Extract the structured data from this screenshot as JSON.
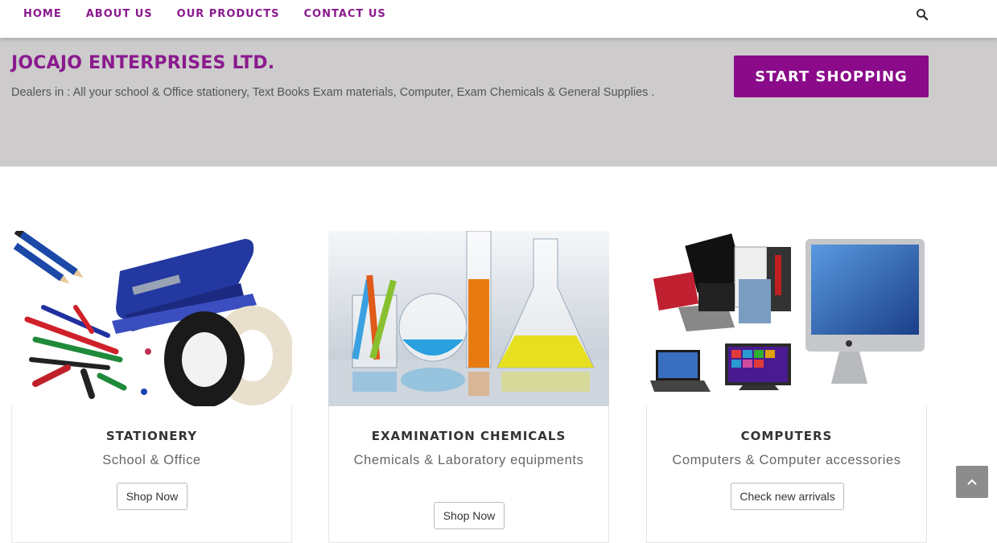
{
  "nav": {
    "items": [
      {
        "label": "HOME"
      },
      {
        "label": "ABOUT US"
      },
      {
        "label": "OUR PRODUCTS"
      },
      {
        "label": "CONTACT US"
      }
    ],
    "search_icon": "search-icon"
  },
  "hero": {
    "title": "JOCAJO ENTERPRISES LTD.",
    "description": "Dealers in : All your school & Office stationery, Text Books Exam materials, Computer, Exam Chemicals & General Supplies .",
    "cta_label": "START SHOPPING"
  },
  "cards": [
    {
      "title": "STATIONERY",
      "subtitle": "School & Office",
      "button": "Shop Now"
    },
    {
      "title": "EXAMINATION CHEMICALS",
      "subtitle": "Chemicals & Laboratory equipments",
      "button": "Shop Now"
    },
    {
      "title": "COMPUTERS",
      "subtitle": "Computers & Computer accessories",
      "button": "Check new arrivals"
    }
  ],
  "colors": {
    "brand": "#8a1a8e",
    "hero_bg": "#cdcbcb",
    "cta_bg": "#8a0a8a",
    "scroll_top_bg": "#8c8c8c"
  }
}
